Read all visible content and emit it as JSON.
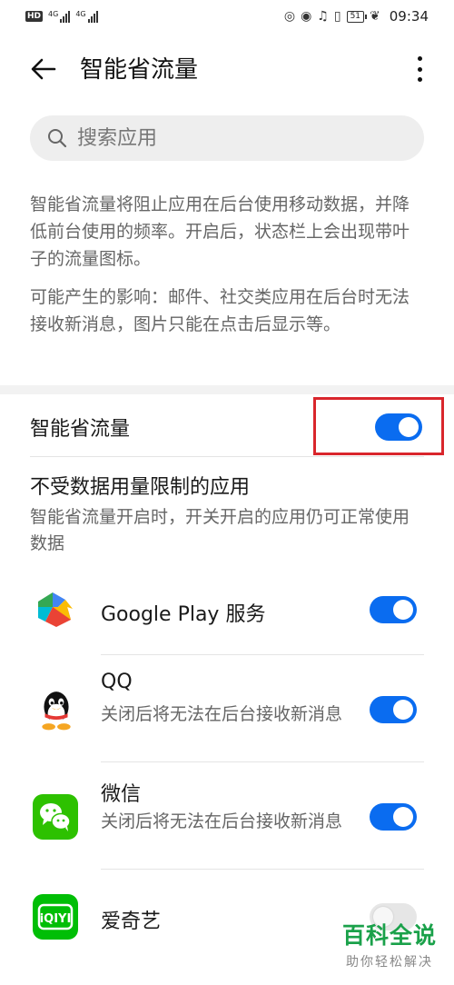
{
  "status_bar": {
    "hd": "HD",
    "net1": "4G",
    "net2": "4G",
    "battery": "51",
    "time": "09:34"
  },
  "header": {
    "title": "智能省流量"
  },
  "search": {
    "placeholder": "搜索应用"
  },
  "description": {
    "p1": "智能省流量将阻止应用在后台使用移动数据，并降低前台使用的频率。开启后，状态栏上会出现带叶子的流量图标。",
    "p2": "可能产生的影响：邮件、社交类应用在后台时无法接收新消息，图片只能在点击后显示等。"
  },
  "main_toggle": {
    "label": "智能省流量",
    "on": true
  },
  "unrestricted": {
    "title": "不受数据用量限制的应用",
    "subtitle": "智能省流量开启时，开关开启的应用仍可正常使用数据"
  },
  "apps": [
    {
      "name": "Google Play 服务",
      "sub": "",
      "on": true
    },
    {
      "name": "QQ",
      "sub": "关闭后将无法在后台接收新消息",
      "on": true
    },
    {
      "name": "微信",
      "sub": "关闭后将无法在后台接收新消息",
      "on": true
    },
    {
      "name": "爱奇艺",
      "sub": "",
      "on": false
    }
  ],
  "watermark": {
    "big": "百科全说",
    "small": "助你轻松解决"
  },
  "colors": {
    "accent": "#0a6cf0",
    "highlight": "#d9262c"
  }
}
